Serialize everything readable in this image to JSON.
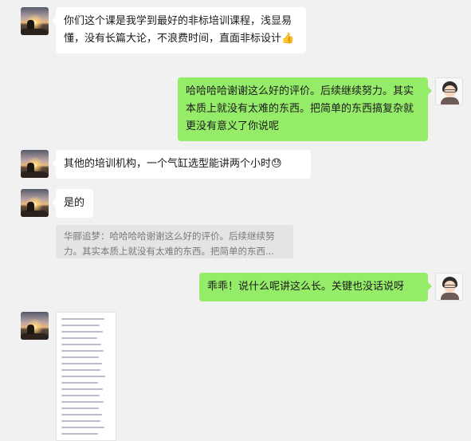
{
  "messages": [
    {
      "side": "left",
      "text": "你们这个课是我学到最好的非标培训课程，浅显易懂，没有长篇大论，不浪费时间，直面非标设计",
      "emoji": "👍"
    },
    {
      "side": "right",
      "text": "哈哈哈哈谢谢这么好的评价。后续继续努力。其实本质上就没有太难的东西。把简单的东西搞复杂就更没有意义了你说呢"
    },
    {
      "side": "left",
      "text": "其他的培训机构，一个气缸选型能讲两个小时",
      "emoji": "😓"
    },
    {
      "side": "left",
      "text": "是的"
    },
    {
      "side": "quote",
      "text": "华郦追梦：哈哈哈哈谢谢这么好的评价。后续继续努力。其实本质上就没有太难的东西。把简单的东西..."
    },
    {
      "side": "right",
      "text": "乖乖！说什么呢讲这么长。关键也没话说呀"
    },
    {
      "side": "left",
      "type": "document-image"
    }
  ],
  "icons": {
    "contact_avatar": "sunset-avatar-icon",
    "self_avatar": "person-avatar-icon",
    "thumbs_up": "thumbs-up-icon",
    "sweat": "sweat-emoji-icon"
  },
  "colors": {
    "background": "#f1f1f1",
    "incoming_bubble": "#ffffff",
    "outgoing_bubble": "#95ec69",
    "quote_bg": "#e4e4e4"
  }
}
